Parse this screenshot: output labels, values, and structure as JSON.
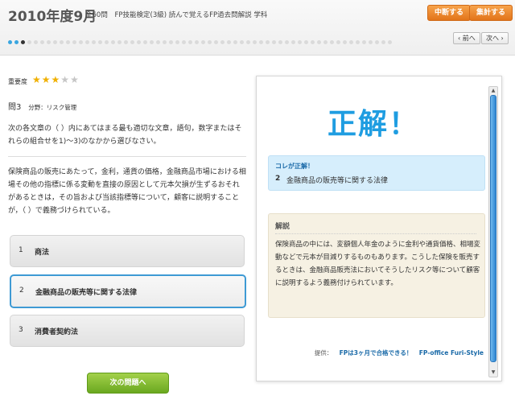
{
  "header": {
    "title": "2010年度9月",
    "total": "全60問",
    "book": "FP技能検定(3級) 読んで覚えるFP過去問解説 学科",
    "suspend_label": "中断する",
    "score_label": "集計する",
    "prev_label": "‹ 前へ",
    "next_label": "次へ ›",
    "progress": {
      "total": 60,
      "current": 3,
      "done": 2
    }
  },
  "question": {
    "difficulty_label": "重要度",
    "stars_on": 3,
    "stars_total": 5,
    "number": "問3",
    "category": "分野：リスク管理",
    "instruction": "次の各文章の（ ）内にあてはまる最も適切な文章，語句，数字またはそれらの組合せを1)〜3)のなかから選びなさい。",
    "problem": "保険商品の販売にあたって，金利，通貨の価格，金融商品市場における相場その他の指標に係る変動を直接の原因として元本欠損が生ずるおそれがあるときは，その旨および当該指標等について，顧客に説明することが，（ ）で義務づけられている。",
    "choices": [
      {
        "num": "1",
        "label": "商法"
      },
      {
        "num": "2",
        "label": "金融商品の販売等に関する法律"
      },
      {
        "num": "3",
        "label": "消費者契約法"
      }
    ],
    "next_question_label": "次の問題へ"
  },
  "result": {
    "verdict": "正解！",
    "answer_label": "コレが正解！",
    "answer_num": "2",
    "answer_text": "金融商品の販売等に関する法律",
    "explain_label": "解説",
    "explain_text": "保険商品の中には、変額個人年金のように金利や通貨価格、相場変動などで元本が目減りするものもあります。こうした保険を販売するときは、金融商品販売法においてそうしたリスク等について顧客に説明するよう義務付けられています。",
    "credit_prefix": "提供：",
    "credit_link1": "FPは3ヶ月で合格できる！",
    "credit_link2": "FP-office Furi-Style"
  },
  "colors": {
    "accent": "#1f9de1",
    "orange": "#e2741a",
    "green": "#6aa820"
  }
}
